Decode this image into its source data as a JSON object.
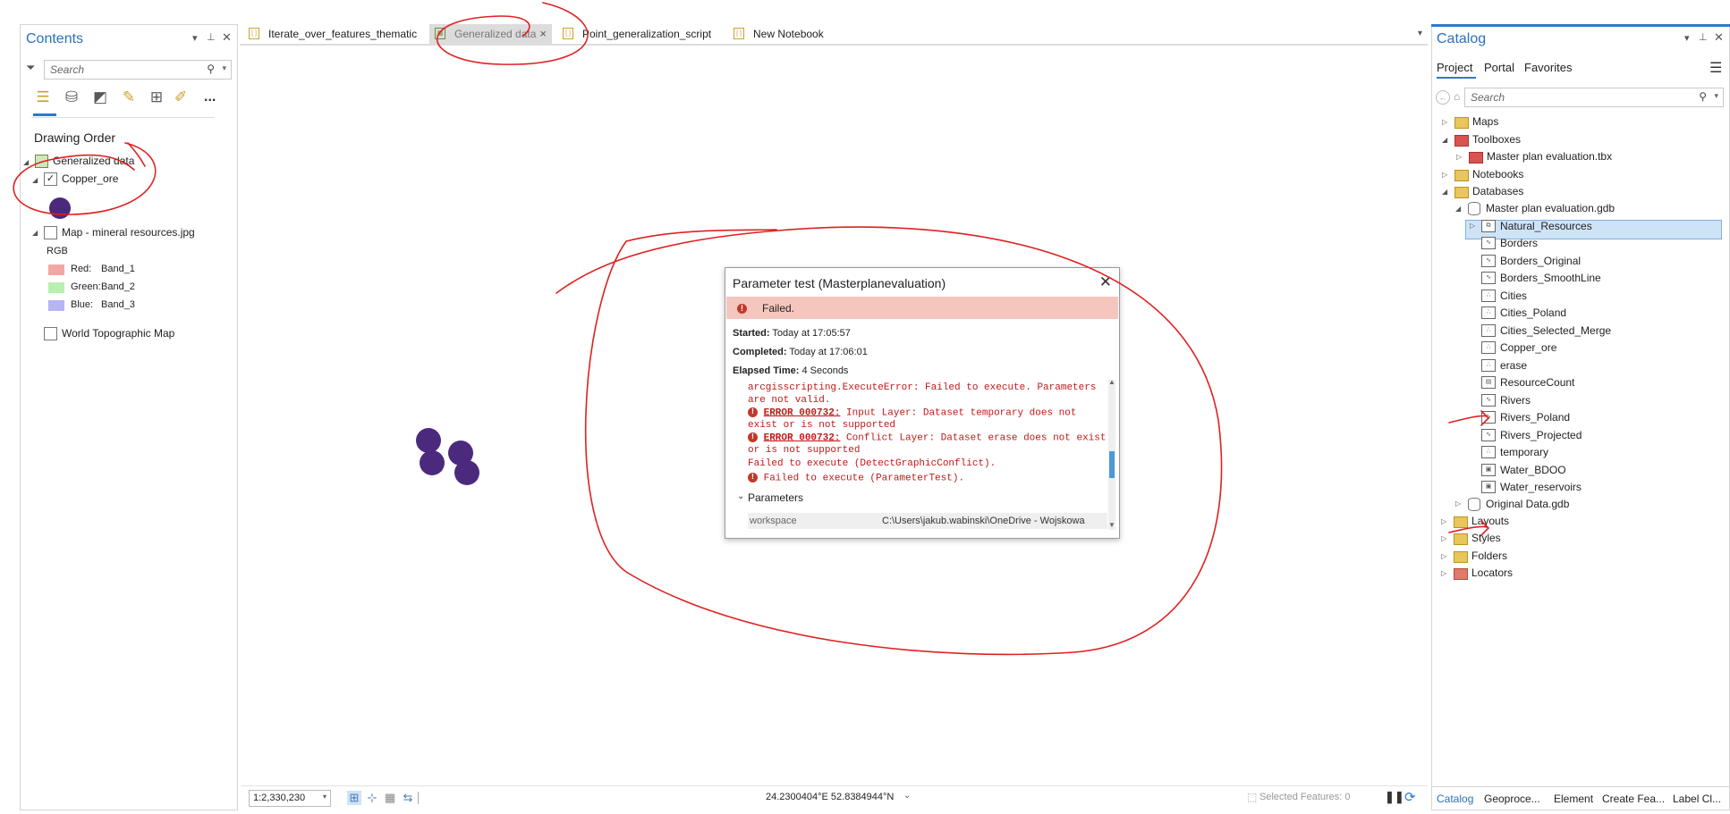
{
  "contents_pane": {
    "title": "Contents",
    "search_placeholder": "Search",
    "section_title": "Drawing Order",
    "map_name": "Generalized data",
    "layers": [
      {
        "name": "Copper_ore",
        "checked": true
      },
      {
        "name": "Map - mineral resources.jpg",
        "checked": false
      },
      {
        "name": "World Topographic Map",
        "checked": false
      }
    ],
    "rgb_label": "RGB",
    "bands": [
      {
        "label": "Red:",
        "band": "Band_1",
        "color": "#f4a6a6"
      },
      {
        "label": "Green:",
        "band": "Band_2",
        "color": "#b8f0b0"
      },
      {
        "label": "Blue:",
        "band": "Band_3",
        "color": "#b5b5f5"
      }
    ],
    "symbol_color": "#4b2a7e",
    "more_label": "..."
  },
  "tabs": [
    {
      "label": "Iterate_over_features_thematic",
      "active": false
    },
    {
      "label": "Generalized data",
      "active": true
    },
    {
      "label": "Point_generalization_script",
      "active": false
    },
    {
      "label": "New Notebook",
      "active": false
    }
  ],
  "tab_close": "×",
  "status_bar": {
    "scale": "1:2,330,230",
    "coordinates": "24.2300404°E 52.8384944°N",
    "selected_features": "Selected Features: 0"
  },
  "dialog": {
    "title": "Parameter test (Masterplanevaluation)",
    "close": "✕",
    "status": "Failed.",
    "started_label": "Started:",
    "started_value": "Today at 17:05:57",
    "completed_label": "Completed:",
    "completed_value": "Today at 17:06:01",
    "elapsed_label": "Elapsed Time:",
    "elapsed_value": "4 Seconds",
    "messages": {
      "line1": "arcgisscripting.ExecuteError: Failed to execute. Parameters",
      "line2": "are not valid.",
      "err1_code": "ERROR 000732:",
      "err1_text": " Input Layer: Dataset temporary does not",
      "err1_line2": "exist or is not supported",
      "err2_code": "ERROR 000732:",
      "err2_text": " Conflict Layer: Dataset erase does not exist",
      "err2_line2": "or is not supported",
      "line_fail1": "Failed to execute (DetectGraphicConflict).",
      "line_fail2": "Failed to execute (ParameterTest)."
    },
    "parameters_header": "Parameters",
    "param_name": "workspace",
    "param_value": "C:\\Users\\jakub.wabinski\\OneDrive - Wojskowa"
  },
  "catalog": {
    "title": "Catalog",
    "tabs": [
      "Project",
      "Portal",
      "Favorites"
    ],
    "search_placeholder": "Search",
    "tree": {
      "maps": "Maps",
      "toolboxes": "Toolboxes",
      "toolbox_item": "Master plan evaluation.tbx",
      "notebooks": "Notebooks",
      "databases": "Databases",
      "gdb": "Master plan evaluation.gdb",
      "natural_resources": "Natural_Resources",
      "items": [
        "Borders",
        "Borders_Original",
        "Borders_SmoothLine",
        "Cities",
        "Cities_Poland",
        "Cities_Selected_Merge",
        "Copper_ore",
        "erase",
        "ResourceCount",
        "Rivers",
        "Rivers_Poland",
        "Rivers_Projected",
        "temporary",
        "Water_BDOO",
        "Water_reservoirs"
      ],
      "original_gdb": "Original Data.gdb",
      "layouts": "Layouts",
      "styles": "Styles",
      "folders": "Folders",
      "locators": "Locators"
    },
    "bottom_tabs": [
      "Catalog",
      "Geoproce...",
      "Element",
      "Create Fea...",
      "Label Cl..."
    ]
  }
}
